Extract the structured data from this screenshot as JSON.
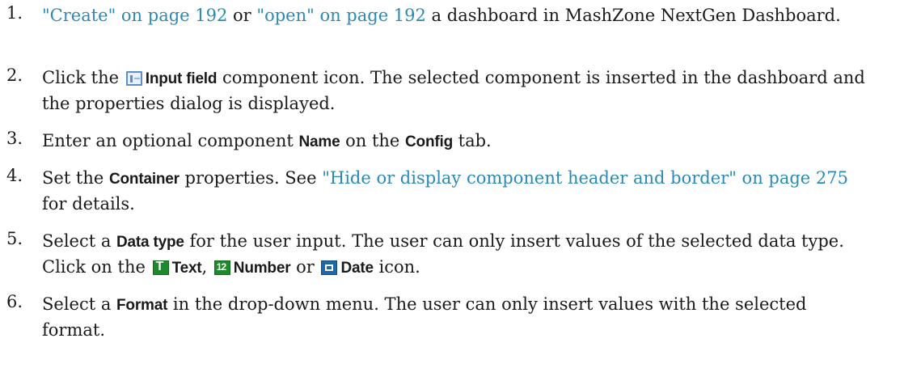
{
  "steps": [
    {
      "num": "1.",
      "link1": "\"Create\" on page 192",
      "or": " or ",
      "link2": "\"open\" on page 192",
      "rest": " a dashboard in MashZone NextGen Dashboard."
    },
    {
      "num": "2.",
      "pre": "Click the ",
      "icon": "input-field-icon",
      "ui": "Input field",
      "rest": " component icon. The selected component is inserted in the dashboard and the properties dialog is displayed."
    },
    {
      "num": "3.",
      "pre": "Enter an optional component ",
      "ui1": "Name",
      "mid": " on the ",
      "ui2": "Config",
      "rest": " tab."
    },
    {
      "num": "4.",
      "pre": "Set the ",
      "ui": "Container",
      "mid": " properties. See ",
      "link": "\"Hide or display component header and border\" on page 275",
      "rest": " for details."
    },
    {
      "num": "5.",
      "pre": "Select a ",
      "ui1": "Data type",
      "mid1": " for the user input. The user can only insert values of the selected data type. Click on the ",
      "icon1": "text-type-icon",
      "ui2": "Text",
      "sep1": ", ",
      "icon2": "number-type-icon",
      "ui3": "Number",
      "sep2": " or ",
      "icon3": "date-type-icon",
      "ui4": "Date",
      "rest": " icon."
    },
    {
      "num": "6.",
      "pre": "Select a ",
      "ui": "Format",
      "rest": " in the drop-down menu. The user can only insert values with the selected format."
    }
  ]
}
